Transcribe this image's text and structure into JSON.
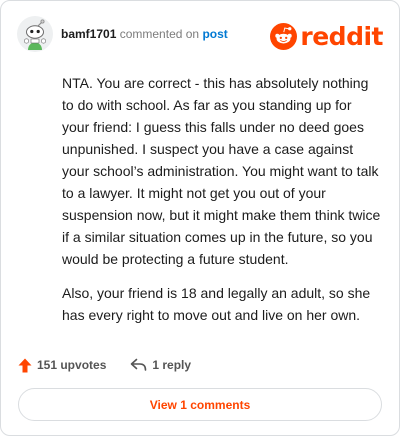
{
  "comment": {
    "username": "bamf1701",
    "action_text": "commented on",
    "post_link": "post",
    "paragraphs": [
      "NTA. You are correct - this has absolutely nothing to do with school. As far as you standing up for your friend: I guess this falls under no deed goes unpunished. I suspect you have a case against your school’s administration. You might want to talk to a lawyer. It might not get you out of your suspension now, but it might make them think twice if a similar situation comes up in the future, so you would be protecting a future student.",
      "Also, your friend is 18 and legally an adult, so she has every right to move out and live on her own."
    ],
    "upvotes": "151 upvotes",
    "replies": "1 reply",
    "view_comments_label": "View 1 comments"
  },
  "brand": {
    "logo_text": "reddit",
    "accent_color": "#ff4500",
    "link_color": "#0079d3"
  },
  "icons": {
    "avatar": "snoo-avatar-icon",
    "logo": "reddit-snoo-icon",
    "upvote": "upvote-arrow-icon",
    "reply": "reply-arrow-icon"
  }
}
